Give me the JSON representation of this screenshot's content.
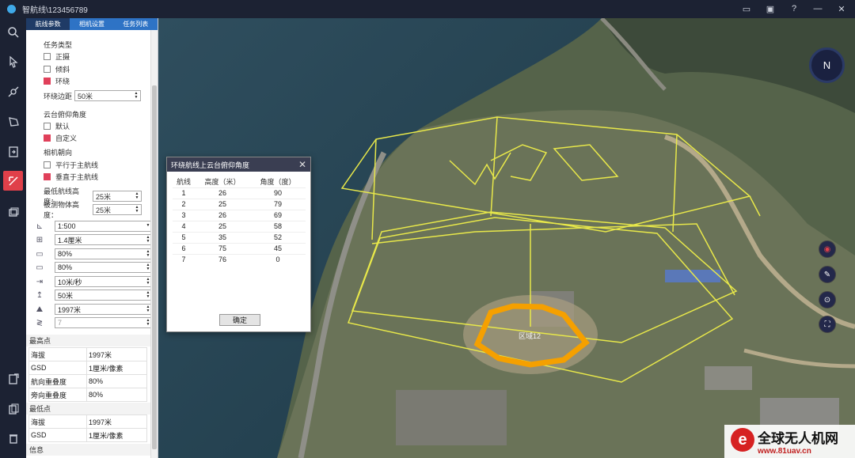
{
  "window": {
    "title": "智航线\\123456789"
  },
  "tabs": [
    "航线参数",
    "相机设置",
    "任务列表"
  ],
  "task_type": {
    "heading": "任务类型",
    "options": [
      {
        "label": "正摄",
        "checked": false
      },
      {
        "label": "倾斜",
        "checked": false
      },
      {
        "label": "环绕",
        "checked": true
      }
    ]
  },
  "orbit_margin": {
    "label": "环绕边距",
    "value": "50米"
  },
  "gimbal": {
    "heading": "云台俯仰角度",
    "options": [
      {
        "label": "默认",
        "checked": false
      },
      {
        "label": "自定义",
        "checked": true
      }
    ]
  },
  "camera_dir": {
    "heading": "相机朝向",
    "options": [
      {
        "label": "平行于主航线",
        "checked": false
      },
      {
        "label": "垂直于主航线",
        "checked": true
      }
    ]
  },
  "min_height": {
    "label": "最低航线高度：",
    "value": "25米"
  },
  "object_height": {
    "label": "被测物体高度：",
    "value": "25米"
  },
  "params": [
    {
      "icon": "scale-icon",
      "glyph": "⊾",
      "value": "1:500",
      "dropdown": true
    },
    {
      "icon": "gsd-icon",
      "glyph": "⊞",
      "value": "1.4厘米"
    },
    {
      "icon": "side-overlap-icon",
      "glyph": "▭",
      "value": "80%"
    },
    {
      "icon": "forward-overlap-icon",
      "glyph": "▭",
      "value": "80%"
    },
    {
      "icon": "speed-icon",
      "glyph": "⇥",
      "value": "10米/秒"
    },
    {
      "icon": "altitude-icon",
      "glyph": "↥",
      "value": "50米"
    },
    {
      "icon": "elevation-icon",
      "glyph": "⛰",
      "value": "1997米"
    },
    {
      "icon": "count-icon",
      "glyph": "≷",
      "value": "7"
    }
  ],
  "highest": {
    "heading": "最高点",
    "rows": [
      [
        "海拔",
        "1997米"
      ],
      [
        "GSD",
        "1厘米/像素"
      ],
      [
        "航向重叠度",
        "80%"
      ],
      [
        "旁向重叠度",
        "80%"
      ]
    ]
  },
  "lowest": {
    "heading": "最低点",
    "rows": [
      [
        "海拔",
        "1997米"
      ],
      [
        "GSD",
        "1厘米/像素"
      ]
    ]
  },
  "info_heading": "信息",
  "dialog": {
    "title": "环绕航线上云台俯仰角度",
    "headers": [
      "航线",
      "高度（米）",
      "角度（度）"
    ],
    "rows": [
      [
        "1",
        "26",
        "90"
      ],
      [
        "2",
        "25",
        "79"
      ],
      [
        "3",
        "26",
        "69"
      ],
      [
        "4",
        "25",
        "58"
      ],
      [
        "5",
        "35",
        "52"
      ],
      [
        "6",
        "75",
        "45"
      ],
      [
        "7",
        "76",
        "0"
      ]
    ],
    "ok_label": "确定"
  },
  "map": {
    "region_label": "区域12",
    "compass_label": "N"
  },
  "watermark": {
    "line1": "全球无人机网",
    "line2": "www.81uav.cn",
    "logo_letter": "e"
  },
  "colors": {
    "accent_tab": "#2e73c5",
    "active_tool": "#e0404a",
    "flight_path": "#e8e84a",
    "region": "#f5a000"
  }
}
